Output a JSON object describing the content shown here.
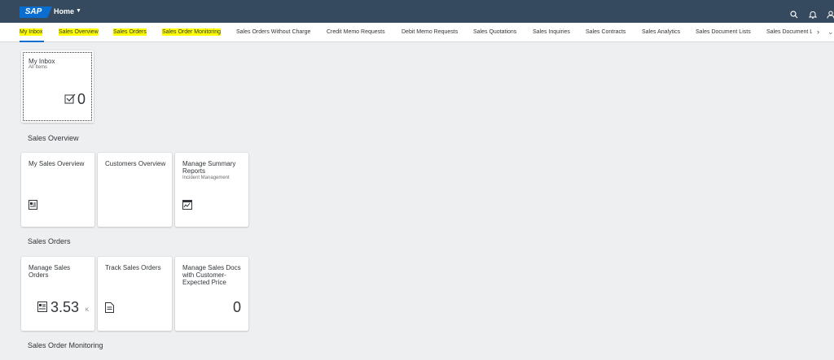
{
  "shell": {
    "logo_text": "SAP",
    "home_title": "Home",
    "icons": [
      "search-icon",
      "bell-icon",
      "user-icon"
    ]
  },
  "anchor_bar": {
    "items": [
      {
        "label": "My Inbox",
        "highlighted": true,
        "selected": true
      },
      {
        "label": "Sales Overview",
        "highlighted": true
      },
      {
        "label": "Sales Orders",
        "highlighted": true
      },
      {
        "label": "Sales Order Monitoring",
        "highlighted": true
      },
      {
        "label": "Sales Orders Without Charge"
      },
      {
        "label": "Credit Memo Requests"
      },
      {
        "label": "Debit Memo Requests"
      },
      {
        "label": "Sales Quotations"
      },
      {
        "label": "Sales Inquiries"
      },
      {
        "label": "Sales Contracts"
      },
      {
        "label": "Sales Analytics"
      },
      {
        "label": "Sales Document Lists"
      },
      {
        "label": "Sales Document L"
      }
    ]
  },
  "inbox_tile": {
    "title": "My Inbox",
    "subtitle": "All Items",
    "icon": "task-check-icon",
    "count": "0"
  },
  "groups": {
    "sales_overview": {
      "title": "Sales Overview",
      "tiles": [
        {
          "title": "My Sales Overview",
          "icon": "overview-card-icon"
        },
        {
          "title": "Customers Overview"
        },
        {
          "title": "Manage Summary Reports",
          "subtitle": "Incident Management",
          "icon": "report-icon"
        }
      ]
    },
    "sales_orders": {
      "title": "Sales Orders",
      "tiles": [
        {
          "title": "Manage Sales Orders",
          "kpi": "3.53",
          "unit": "K",
          "icon": "sales-order-icon"
        },
        {
          "title": "Track Sales Orders",
          "icon": "document-icon"
        },
        {
          "title": "Manage Sales Docs with Customer-Expected Price",
          "kpi": "0"
        }
      ]
    },
    "sales_order_monitoring": {
      "title": "Sales Order Monitoring"
    }
  },
  "colors": {
    "shell": "#354a5f",
    "accent": "#0a6ed1",
    "highlight": "#ffff00",
    "background": "#edeff0"
  }
}
